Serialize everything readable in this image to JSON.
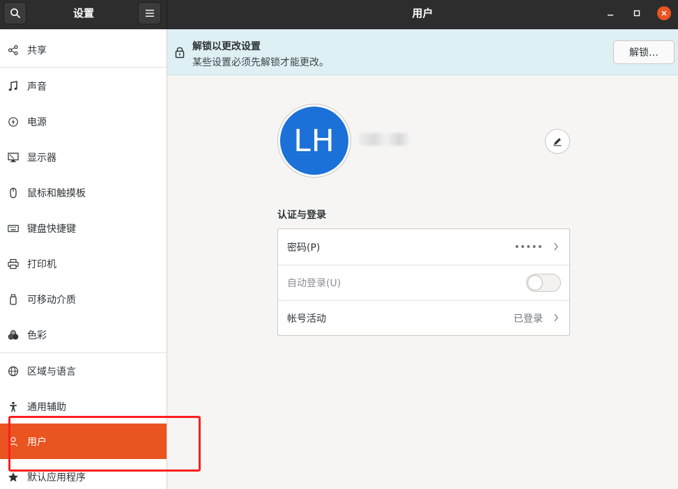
{
  "header": {
    "left_title": "设置",
    "main_title": "用户"
  },
  "sidebar": {
    "items": [
      {
        "label": "共享",
        "icon": "share-icon"
      },
      {
        "label": "声音",
        "icon": "music-note-icon"
      },
      {
        "label": "电源",
        "icon": "power-icon"
      },
      {
        "label": "显示器",
        "icon": "display-icon"
      },
      {
        "label": "鼠标和触摸板",
        "icon": "mouse-icon"
      },
      {
        "label": "键盘快捷键",
        "icon": "keyboard-icon"
      },
      {
        "label": "打印机",
        "icon": "printer-icon"
      },
      {
        "label": "可移动介质",
        "icon": "removable-media-icon"
      },
      {
        "label": "色彩",
        "icon": "color-icon"
      },
      {
        "label": "区域与语言",
        "icon": "globe-icon"
      },
      {
        "label": "通用辅助",
        "icon": "accessibility-icon"
      },
      {
        "label": "用户",
        "icon": "user-icon"
      },
      {
        "label": "默认应用程序",
        "icon": "star-icon"
      }
    ],
    "active_index": 11
  },
  "infobar": {
    "title": "解锁以更改设置",
    "subtitle": "某些设置必须先解锁才能更改。",
    "unlock_label": "解锁…"
  },
  "user": {
    "initials": "LH"
  },
  "auth": {
    "section_title": "认证与登录",
    "password_label": "密码(P)",
    "password_value": "•••••",
    "autologin_label": "自动登录(U)",
    "autologin_on": false,
    "activity_label": "帐号活动",
    "activity_value": "已登录"
  },
  "colors": {
    "accent": "#e95420",
    "avatar": "#1c71d8",
    "headerbar": "#2d2d2d",
    "infobar": "#dff0f4",
    "highlight": "#ff1e1e"
  }
}
